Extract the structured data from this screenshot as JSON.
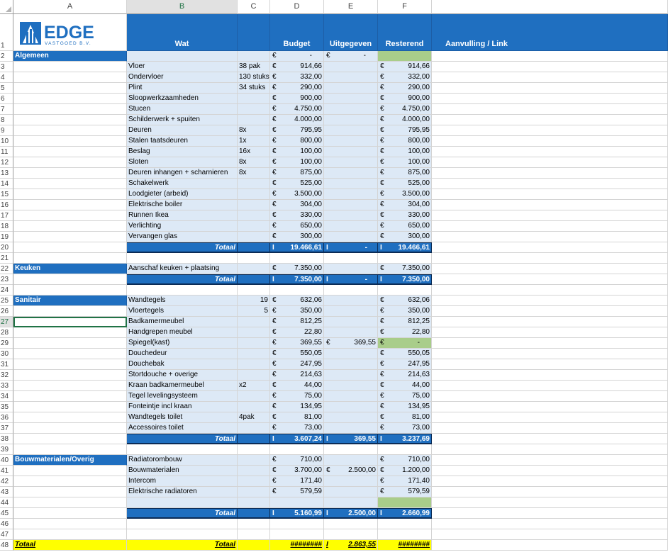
{
  "columns": [
    "A",
    "B",
    "C",
    "D",
    "E",
    "F"
  ],
  "logo": {
    "name": "EDGE",
    "sub": "VASTGOED B.V.",
    "color": "#1f6fc0"
  },
  "header": {
    "wat": "Wat",
    "budget": "Budget",
    "uitgegeven": "Uitgegeven",
    "resterend": "Resterend",
    "aanvulling": "Aanvulling / Link"
  },
  "rows": [
    {
      "n": "2",
      "type": "cat",
      "a": "Algemeen",
      "b": "",
      "c": "",
      "d": "-",
      "e": "-",
      "f": "",
      "fgreen": true
    },
    {
      "n": "3",
      "b": "Vloer",
      "c": "38 pak",
      "d": "914,66",
      "f": "914,66"
    },
    {
      "n": "4",
      "b": "Ondervloer",
      "c": "130 stuks",
      "d": "332,00",
      "f": "332,00"
    },
    {
      "n": "5",
      "b": "Plint",
      "c": "34 stuks",
      "d": "290,00",
      "f": "290,00"
    },
    {
      "n": "6",
      "b": "Sloopwerkzaamheden",
      "d": "900,00",
      "f": "900,00"
    },
    {
      "n": "7",
      "b": "Stucen",
      "d": "4.750,00",
      "f": "4.750,00"
    },
    {
      "n": "8",
      "b": "Schilderwerk + spuiten",
      "d": "4.000,00",
      "f": "4.000,00"
    },
    {
      "n": "9",
      "b": "Deuren",
      "c": "8x",
      "d": "795,95",
      "f": "795,95"
    },
    {
      "n": "10",
      "b": "Stalen taatsdeuren",
      "c": "1x",
      "d": "800,00",
      "f": "800,00"
    },
    {
      "n": "11",
      "b": "Beslag",
      "c": "16x",
      "d": "100,00",
      "f": "100,00"
    },
    {
      "n": "12",
      "b": "Sloten",
      "c": "8x",
      "d": "100,00",
      "f": "100,00"
    },
    {
      "n": "13",
      "b": "Deuren inhangen + scharnieren",
      "c": "8x",
      "d": "875,00",
      "f": "875,00"
    },
    {
      "n": "14",
      "b": "Schakelwerk",
      "d": "525,00",
      "f": "525,00"
    },
    {
      "n": "15",
      "b": "Loodgieter (arbeid)",
      "d": "3.500,00",
      "f": "3.500,00"
    },
    {
      "n": "16",
      "b": "Elektrische boiler",
      "d": "304,00",
      "f": "304,00"
    },
    {
      "n": "17",
      "b": "Runnen Ikea",
      "d": "330,00",
      "f": "330,00"
    },
    {
      "n": "18",
      "b": "Verlichting",
      "d": "650,00",
      "f": "650,00"
    },
    {
      "n": "19",
      "b": "Vervangen glas",
      "d": "300,00",
      "f": "300,00"
    },
    {
      "n": "20",
      "type": "total",
      "b": "Totaal",
      "d": "19.466,61",
      "e": "-",
      "f": "19.466,61"
    },
    {
      "n": "21",
      "type": "blank"
    },
    {
      "n": "22",
      "type": "cat",
      "a": "Keuken",
      "b": "Aanschaf keuken + plaatsing",
      "d": "7.350,00",
      "f": "7.350,00"
    },
    {
      "n": "23",
      "type": "total",
      "b": "Totaal",
      "d": "7.350,00",
      "e": "-",
      "f": "7.350,00"
    },
    {
      "n": "24",
      "type": "blank"
    },
    {
      "n": "25",
      "type": "cat",
      "a": "Sanitair",
      "b": "Wandtegels",
      "c": "19",
      "cnum": true,
      "d": "632,06",
      "f": "632,06"
    },
    {
      "n": "26",
      "b": "Vloertegels",
      "c": "5",
      "cnum": true,
      "d": "350,00",
      "f": "350,00"
    },
    {
      "n": "27",
      "b": "Badkamermeubel",
      "d": "812,25",
      "f": "812,25",
      "selected": true
    },
    {
      "n": "28",
      "b": "Handgrepen meubel",
      "d": "22,80",
      "f": "22,80"
    },
    {
      "n": "29",
      "b": "Spiegel(kast)",
      "d": "369,55",
      "e": "369,55",
      "f": "-",
      "fgreen": true
    },
    {
      "n": "30",
      "b": "Douchedeur",
      "d": "550,05",
      "f": "550,05"
    },
    {
      "n": "31",
      "b": "Douchebak",
      "d": "247,95",
      "f": "247,95"
    },
    {
      "n": "32",
      "b": "Stortdouche + overige",
      "d": "214,63",
      "f": "214,63"
    },
    {
      "n": "33",
      "b": "Kraan badkamermeubel",
      "c": "x2",
      "d": "44,00",
      "f": "44,00"
    },
    {
      "n": "34",
      "b": "Tegel levelingsysteem",
      "d": "75,00",
      "f": "75,00"
    },
    {
      "n": "35",
      "b": "Fonteintje incl kraan",
      "d": "134,95",
      "f": "134,95"
    },
    {
      "n": "36",
      "b": "Wandtegels toilet",
      "c": "4pak",
      "d": "81,00",
      "f": "81,00"
    },
    {
      "n": "37",
      "b": "Accessoires toilet",
      "d": "73,00",
      "f": "73,00"
    },
    {
      "n": "38",
      "type": "total",
      "b": "Totaal",
      "d": "3.607,24",
      "e": "369,55",
      "f": "3.237,69"
    },
    {
      "n": "39",
      "type": "blank"
    },
    {
      "n": "40",
      "type": "cat",
      "a": "Bouwmaterialen/Overig",
      "b": "Radiatorombouw",
      "d": "710,00",
      "f": "710,00"
    },
    {
      "n": "41",
      "b": "Bouwmaterialen",
      "d": "3.700,00",
      "e": "2.500,00",
      "f": "1.200,00"
    },
    {
      "n": "42",
      "b": "Intercom",
      "d": "171,40",
      "f": "171,40"
    },
    {
      "n": "43",
      "b": "Elektrische radiatoren",
      "d": "579,59",
      "f": "579,59"
    },
    {
      "n": "44",
      "b": "",
      "fgreen": true,
      "nocur": true
    },
    {
      "n": "45",
      "type": "total",
      "b": "Totaal",
      "d": "5.160,99",
      "e": "2.500,00",
      "f": "2.660,99"
    },
    {
      "n": "46",
      "type": "blank"
    },
    {
      "n": "47",
      "type": "blank"
    },
    {
      "n": "48",
      "type": "grand",
      "a": "Totaal",
      "b": "Totaal",
      "d": "########",
      "e": "2.863,55",
      "f": "########"
    }
  ],
  "currency_symbol": "€",
  "total_marker": "I",
  "colors": {
    "blue": "#1f6fc0",
    "lightblue": "#dde9f6",
    "green": "#a9cd8a",
    "yellow": "#ffff00"
  }
}
